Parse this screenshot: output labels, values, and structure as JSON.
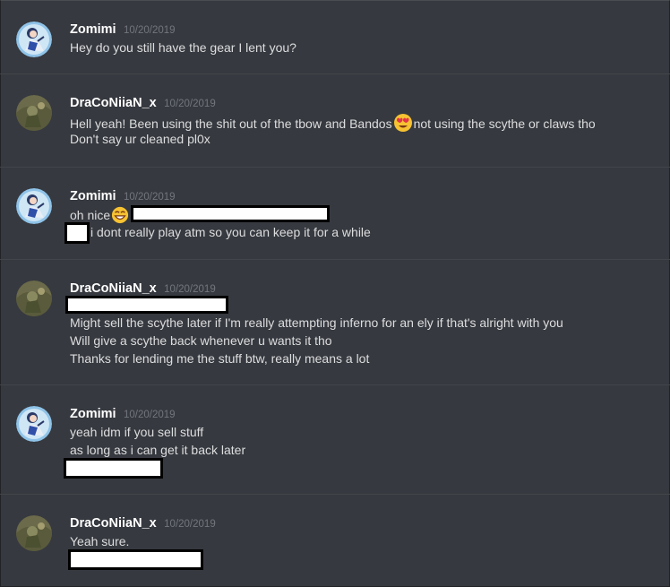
{
  "messages": [
    {
      "author": "Zomimi",
      "timestamp": "10/20/2019",
      "avatar": "zomimi-avatar",
      "lines": [
        "Hey do you still have the gear I lent you?"
      ]
    },
    {
      "author": "DraCoNiiaN_x",
      "timestamp": "10/20/2019",
      "avatar": "draconiian-avatar",
      "lines": [
        {
          "before": "Hell yeah! Been using the shit out of the tbow and Bandos",
          "emoji": "heart-eyes-emoji",
          "after": "not using the scythe or claws tho"
        },
        "Don't say ur cleaned pl0x"
      ]
    },
    {
      "author": "Zomimi",
      "timestamp": "10/20/2019",
      "avatar": "zomimi-avatar",
      "lines": [
        {
          "before": "oh nice",
          "emoji": "grinning-emoji"
        },
        "i dont really play atm so you can keep it for a while"
      ]
    },
    {
      "author": "DraCoNiiaN_x",
      "timestamp": "10/20/2019",
      "avatar": "draconiian-avatar",
      "lines": [
        "Might sell the scythe later if I'm really attempting inferno for an ely if that's alright with you",
        "Will give a scythe back whenever u wants it tho",
        "Thanks for lending me the stuff btw, really means a lot"
      ]
    },
    {
      "author": "Zomimi",
      "timestamp": "10/20/2019",
      "avatar": "zomimi-avatar",
      "lines": [
        "yeah idm if you sell stuff",
        "as long as i can get it back later"
      ]
    },
    {
      "author": "DraCoNiiaN_x",
      "timestamp": "10/20/2019",
      "avatar": "draconiian-avatar",
      "lines": [
        "Yeah sure."
      ]
    }
  ],
  "colors": {
    "background": "#36393f",
    "author": "#ffffff",
    "timestamp": "#72767d",
    "text": "#dcddde",
    "divider": "#42454a"
  }
}
